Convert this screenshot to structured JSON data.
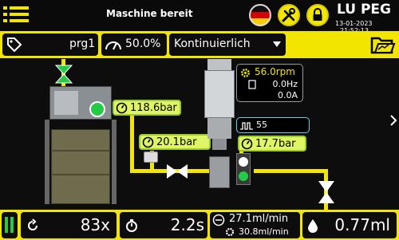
{
  "header": {
    "status": "Maschine bereit",
    "logo": "LU PEG",
    "date": "13-01-2023",
    "time": "21:52:13"
  },
  "program": {
    "name": "prg1",
    "speed_percent": "50.0%",
    "mode": "Kontinuierlich"
  },
  "gauges": {
    "top": "118.6bar",
    "middle": "20.1bar",
    "right": "17.7bar"
  },
  "motor": {
    "rpm": "56.0rpm",
    "hz": "0.0Hz",
    "amps": "0.0A"
  },
  "counter_box": {
    "value": "55"
  },
  "footer": {
    "count": "83x",
    "time": "2.2s",
    "flow_primary": "27.1ml/min",
    "flow_secondary": "30.8ml/min",
    "volume": "0.77ml"
  },
  "colors": {
    "accent_yellow": "#f2e600",
    "gauge_green": "#dff565",
    "valve_green": "#22cc44",
    "background": "#0d0d0d"
  },
  "icons": {
    "menu": "menu-icon",
    "language": "german-flag-icon",
    "tools": "wrench-screwdriver-icon",
    "lock": "lock-icon",
    "tag": "tag-icon",
    "speedometer": "speedometer-icon",
    "dropdown": "chevron-down-icon",
    "folder": "folder-icon",
    "gear": "gear-icon",
    "refresh": "refresh-icon",
    "stopwatch": "stopwatch-icon",
    "flow": "flow-icon",
    "drop": "drop-icon",
    "pause": "pause-icon",
    "next": "chevron-right-icon"
  }
}
